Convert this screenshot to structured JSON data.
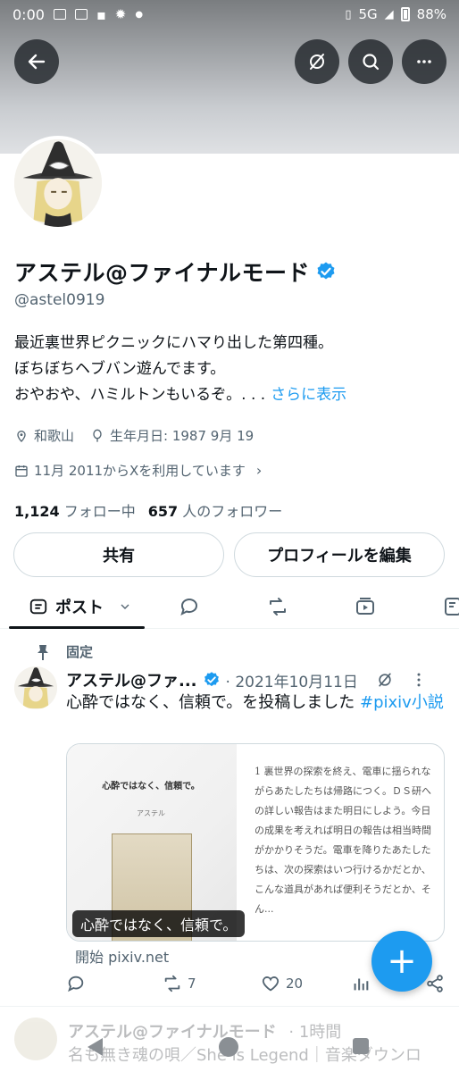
{
  "status_bar": {
    "time": "0:00",
    "network": "5G",
    "battery": "88%"
  },
  "profile": {
    "name": "アステル@ファイナルモード",
    "handle": "@astel0919",
    "bio_lines": [
      "最近裏世界ピクニックにハマり出した第四種。",
      "ぼちぼちヘブバン遊んでます。",
      "おやおや、ハミルトンもいるぞ。. . ."
    ],
    "bio_more": "さらに表示",
    "location": "和歌山",
    "birthday": "生年月日: 1987 9月 19",
    "joined": "11月 2011からXを利用しています",
    "following_count": "1,124",
    "following_label": "フォロー中",
    "followers_count": "657",
    "followers_label": "人のフォロワー",
    "share_button": "共有",
    "edit_button": "プロフィールを編集"
  },
  "tabs": {
    "active_label": "ポスト"
  },
  "pinned_post": {
    "pinned_label": "固定",
    "author": "アステル@ファ...",
    "date": "· 2021年10月11日",
    "text": "心酔ではなく、信頼で。を投稿しました ",
    "hashtag": "#pixiv小説",
    "card": {
      "title": "心酔ではなく、信頼で。",
      "author": "アステル",
      "excerpt": "1 裏世界の探索を終え、電車に揺られながらあたしたちは帰路につく。ＤＳ研への詳しい報告はまた明日にしよう。今日の成果を考えれば明日の報告は相当時間がかかりそうだ。電車を降りたあたしたちは、次の探索はいつ行けるかだとか、こんな道具があれば便利そうだとか、そん...",
      "caption": "心酔ではなく、信頼で。",
      "domain": "開始 pixiv.net"
    },
    "retweets": "7",
    "likes": "20"
  },
  "next_post": {
    "author": "アステル@ファイナルモード",
    "time": "· 1時間",
    "text": "名も無き魂の唄／She is Legend｜音楽ダウンロ"
  },
  "fab_label": "+"
}
